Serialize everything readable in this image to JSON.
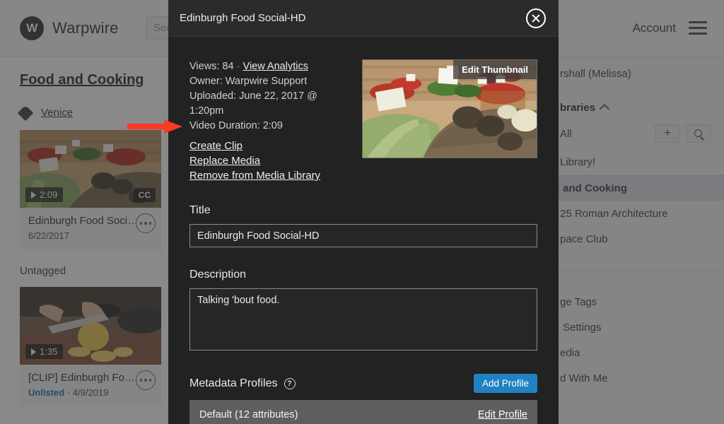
{
  "app": {
    "brand_initial": "W",
    "brand_name": "Warpwire",
    "search_placeholder": "Search",
    "account_label": "Account",
    "menu_icon": "hamburger-icon"
  },
  "main": {
    "page_title": "Food and Cooking",
    "tag": {
      "icon": "tag-icon",
      "label": "Venice"
    },
    "untagged_label": "Untagged",
    "cards": [
      {
        "duration": "2:09",
        "cc": "CC",
        "title": "Edinburgh Food Soci…",
        "date": "6/22/2017",
        "status": "",
        "kebab": "more-options-icon"
      },
      {
        "duration": "1:35",
        "cc": "",
        "title": "[CLIP] Edinburgh Fo…",
        "date": "4/9/2019",
        "status": "Unlisted",
        "separator": "·",
        "kebab": "more-options-icon"
      }
    ]
  },
  "sidebar": {
    "user": "…rshall (Melissa)",
    "libraries_heading": "…braries",
    "collapse_icon": "chevron-up-icon",
    "add_icon": "plus-icon",
    "search_icon": "search-icon",
    "items": [
      {
        "label": "…All",
        "selected": false,
        "has_buttons": true
      },
      {
        "label": "…Library!",
        "selected": false,
        "has_buttons": false
      },
      {
        "label": "… and Cooking",
        "selected": true,
        "has_buttons": false
      },
      {
        "label": "…25 Roman Architecture",
        "selected": false,
        "has_buttons": false
      },
      {
        "label": "…pace Club",
        "selected": false,
        "has_buttons": false
      }
    ],
    "links": [
      {
        "label": "…ge Tags"
      },
      {
        "label": "… Settings"
      },
      {
        "label": "…edia"
      },
      {
        "label": "…d With Me"
      }
    ]
  },
  "modal": {
    "title": "Edinburgh Food Social-HD",
    "close_icon": "close-icon",
    "details": {
      "views_label": "Views:",
      "views_count": "84",
      "separator": "·",
      "analytics_link": "View Analytics",
      "owner": "Owner: Warpwire Support",
      "uploaded": "Uploaded: June 22, 2017 @ 1:20pm",
      "duration": "Video Duration: 2:09"
    },
    "actions": [
      {
        "label": "Create Clip",
        "name": "create-clip-link"
      },
      {
        "label": "Replace Media",
        "name": "replace-media-link"
      },
      {
        "label": "Remove from Media Library",
        "name": "remove-from-media-library-link"
      }
    ],
    "thumbnail": {
      "edit_label": "Edit Thumbnail"
    },
    "title_field": {
      "label": "Title",
      "value": "Edinburgh Food Social-HD",
      "placeholder": "Title"
    },
    "description_field": {
      "label": "Description",
      "value": "Talking 'bout food.",
      "placeholder": "Description"
    },
    "metadata": {
      "heading": "Metadata Profiles",
      "help_icon": "?",
      "add_button": "Add Profile",
      "profiles": [
        {
          "name": "Default (12 attributes)",
          "edit_label": "Edit Profile"
        }
      ]
    }
  },
  "annotation": {
    "arrow_color": "#f73b28",
    "points_at": "Create Clip"
  }
}
